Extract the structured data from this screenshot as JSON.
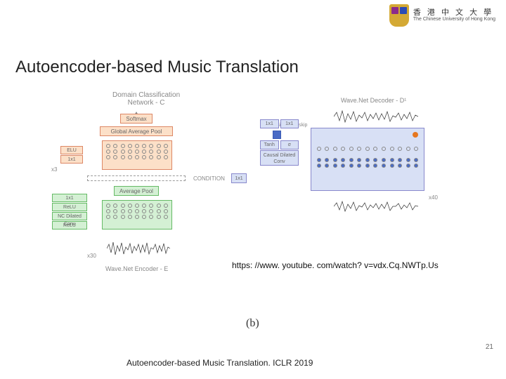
{
  "university": {
    "cn": "香 港 中 文 大 學",
    "en": "The Chinese University of Hong Kong"
  },
  "title": "Autoencoder-based Music Translation",
  "dcn": {
    "label1": "Domain Classification",
    "label2": "Network - C",
    "softmax": "Softmax",
    "gap": "Global Average Pool",
    "elu": "ELU",
    "oneone": "1x1",
    "x3": "x3"
  },
  "enc": {
    "avgpool": "Average Pool",
    "oneone": "1x1",
    "relu": "ReLU",
    "ncdil": "NC Dilated Conv",
    "x30": "x30",
    "label": "Wave.Net Encoder - E"
  },
  "cond": {
    "text": "CONDITION",
    "oneone": "1x1"
  },
  "dec": {
    "label": "Wave.Net Decoder - D¹",
    "res": "residual",
    "skip": "skip",
    "oneone": "1x1",
    "tanh": "Tanh",
    "sigma": "σ",
    "causal": "Causal Dilated\nConv",
    "x40": "x40"
  },
  "link": "https: //www. youtube. com/watch? v=vdx.Cq.NWTp.Us",
  "blabel": "(b)",
  "footer": "Autoencoder-based Music Translation. ICLR 2019",
  "pagenum": "21"
}
